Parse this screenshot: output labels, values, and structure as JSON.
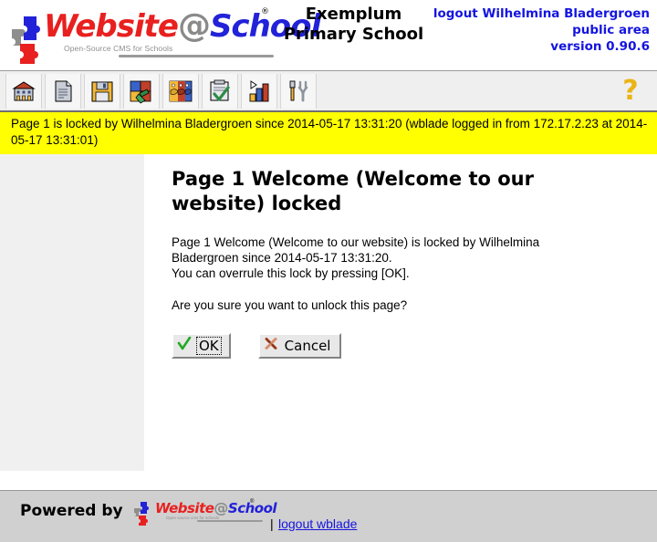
{
  "header": {
    "logo": {
      "word_part1": "Website",
      "word_at": "@",
      "word_part2": "School",
      "registered": "®",
      "tagline": "Open-Source CMS for Schools"
    },
    "school_title_line1": "Exemplum",
    "school_title_line2": "Primary School",
    "right": {
      "logout_label": "logout Wilhelmina Bladergroen",
      "area_label": "public area",
      "version_label": "version 0.90.6"
    }
  },
  "toolbar": {
    "items": [
      {
        "name": "school-icon",
        "title": "School"
      },
      {
        "name": "page-icon",
        "title": "Pages"
      },
      {
        "name": "save-disk-icon",
        "title": "Save"
      },
      {
        "name": "modules-puzzle-icon",
        "title": "Modules"
      },
      {
        "name": "users-faces-icon",
        "title": "Users"
      },
      {
        "name": "checklist-icon",
        "title": "Tasks"
      },
      {
        "name": "statistics-chart-icon",
        "title": "Statistics"
      },
      {
        "name": "tools-icon",
        "title": "Tools"
      }
    ],
    "help_label": "?"
  },
  "message_bar": {
    "text": "Page 1 is locked by Wilhelmina Bladergroen since 2014-05-17 13:31:20 (wblade logged in from 172.17.2.23 at 2014-05-17 13:31:01)",
    "background_color": "#ffff00"
  },
  "main": {
    "page_title": "Page 1 Welcome (Welcome to our website) locked",
    "paragraph_1_line1": "Page 1 Welcome (Welcome to our website) is locked by Wilhelmina",
    "paragraph_1_line2": "Bladergroen since 2014-05-17 13:31:20.",
    "paragraph_1_line3": "You can overrule this lock by pressing [OK].",
    "paragraph_2": "Are you sure you want to unlock this page?",
    "buttons": {
      "ok_label": "OK",
      "cancel_label": "Cancel"
    }
  },
  "footer": {
    "powered_by_label": "Powered by",
    "logo": {
      "word_part1": "Website",
      "word_at": "@",
      "word_part2": "School",
      "registered": "®",
      "tagline": "Open source cms for schools"
    },
    "separator": "|",
    "logout_link_label": "logout wblade"
  },
  "colors": {
    "accent_blue": "#1414e0",
    "logo_red": "#e8201f",
    "logo_gray": "#8a8a8a",
    "warning_yellow": "#ffff00",
    "footer_gray": "#d0d0d0",
    "sidebar_gray": "#f0f0f0",
    "help_gold": "#eab416",
    "ok_green": "#22aa22",
    "cancel_red": "#aa4422"
  }
}
